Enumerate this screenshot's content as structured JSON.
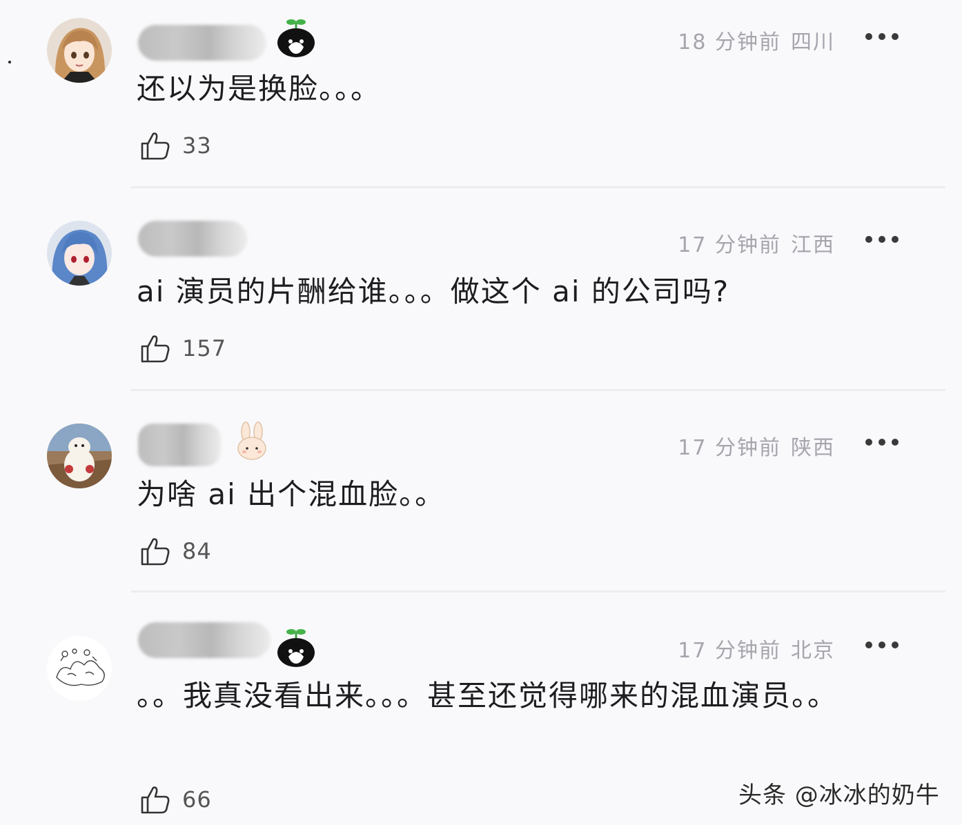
{
  "comments": [
    {
      "time": "18 分钟前",
      "location": "四川",
      "text": "还以为是换脸。。。",
      "likes": "33",
      "avatar": "anime-girl-brown-hair",
      "badge": "cat-sprout-badge"
    },
    {
      "time": "17 分钟前",
      "location": "江西",
      "text": "ai 演员的片酬给谁。。。做这个 ai 的公司吗?",
      "likes": "157",
      "avatar": "anime-girl-blue-hair",
      "badge": ""
    },
    {
      "time": "17 分钟前",
      "location": "陕西",
      "text": "为啥 ai 出个混血脸。。",
      "likes": "84",
      "avatar": "cartoon-dog-photo",
      "badge": "bunny-badge"
    },
    {
      "time": "17 分钟前",
      "location": "北京",
      "text": "。。我真没看出来。。。甚至还觉得哪来的混血演员。。",
      "likes": "66",
      "avatar": "sketch-doodle",
      "badge": "cat-sprout-badge"
    }
  ],
  "watermark": "头条 @冰冰的奶牛",
  "colors": {
    "background": "#f9f9fb",
    "meta": "#a5a5ad",
    "text": "#1d1d1f"
  }
}
